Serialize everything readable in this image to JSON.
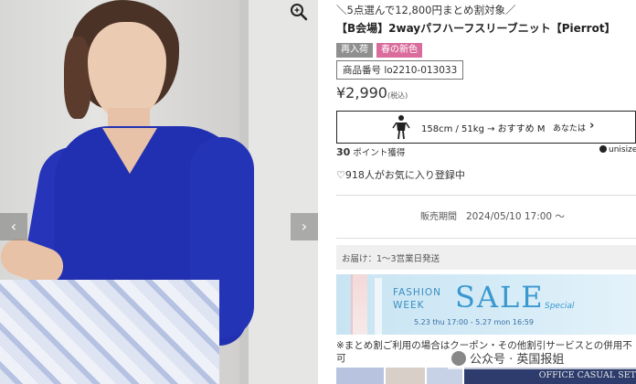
{
  "gallery": {
    "prev_label": "‹",
    "next_label": "›",
    "zoom_icon": "search-icon"
  },
  "product": {
    "bulk_offer": "＼5点選んで12,800円まとめ割対象／",
    "title": "【B会場】2wayパフハーフスリーブニット【Pierrot】",
    "tags": [
      "再入荷",
      "春の新色"
    ],
    "code": "商品番号 lo2210-013033",
    "price": "¥2,990",
    "price_tax": "(税込)",
    "size_guide": {
      "model_spec": "158cm / 51kg → おすすめ M",
      "you_label": "あなたは",
      "chevron": "›"
    },
    "points_value": "30",
    "points_label": "ポイント獲得",
    "unisize": "unisize",
    "favorites": "♡918人がお気に入り登録中",
    "sale_period_label": "販売期間",
    "sale_period_value": "2024/05/10 17:00 〜",
    "delivery": "お届け：1〜3営業日発送"
  },
  "banner": {
    "fashion": "FASHION",
    "week": "WEEK",
    "sale": "SALE",
    "special": "Special",
    "dates": "5.23 thu 17:00 - 5.27 mon 16:59"
  },
  "notice": "※まとめ割ご利用の場合はクーポン・その他割引サービスとの併用不可",
  "thumb_banner": "OFFICE CASUAL SET",
  "watermark": "公众号 · 英国报姐",
  "colors": {
    "spring_tag": "#d96c9c",
    "restock_tag": "#8f8f8f",
    "sweater": "#2130b0",
    "sale_blue": "#3a98cf"
  }
}
